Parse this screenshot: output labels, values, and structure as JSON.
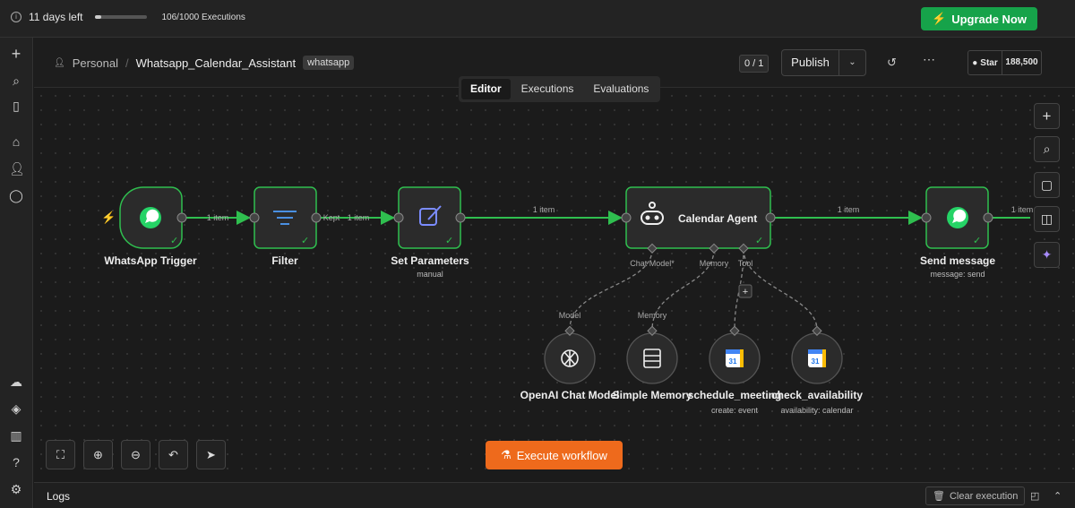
{
  "trial": {
    "days_left": "11 days left",
    "executions": "106/1000 Executions",
    "progress": 0.106
  },
  "upgrade_label": "Upgrade Now",
  "header": {
    "project": "Personal",
    "workflow": "Whatsapp_Calendar_Assistant",
    "tag": "whatsapp",
    "pager": "0 / 1",
    "publish": "Publish",
    "star": "Star",
    "stars_count": "188,500"
  },
  "tabs": [
    "Editor",
    "Executions",
    "Evaluations"
  ],
  "nodes": {
    "trigger": {
      "label": "WhatsApp Trigger"
    },
    "filter": {
      "label": "Filter"
    },
    "set": {
      "label": "Set Parameters",
      "sub": "manual"
    },
    "agent": {
      "label": "Calendar Agent"
    },
    "send": {
      "label": "Send message",
      "sub": "message: send"
    },
    "openai": {
      "label": "OpenAI Chat Model"
    },
    "memory": {
      "label": "Simple Memory"
    },
    "schedule": {
      "label": "schedule_meeting",
      "sub": "create: event"
    },
    "check": {
      "label": "check_availability",
      "sub": "availability: calendar"
    }
  },
  "edges": {
    "e1": "1 item",
    "e2_kept": "Kept",
    "e2": "1 item",
    "e3": "1 item",
    "e4": "1 item",
    "e5": "1 item"
  },
  "ports": {
    "chat_model": "Chat Model*",
    "memory": "Memory",
    "tool": "Tool",
    "model": "Model",
    "memory_in": "Memory"
  },
  "execute_label": "Execute workflow",
  "logs": {
    "title": "Logs",
    "clear": "Clear execution"
  },
  "colors": {
    "accent_green": "#16a34a",
    "node_border": "#2fbf4f",
    "execute_orange": "#ee6a1c",
    "google_calendar": "#4285f4"
  }
}
